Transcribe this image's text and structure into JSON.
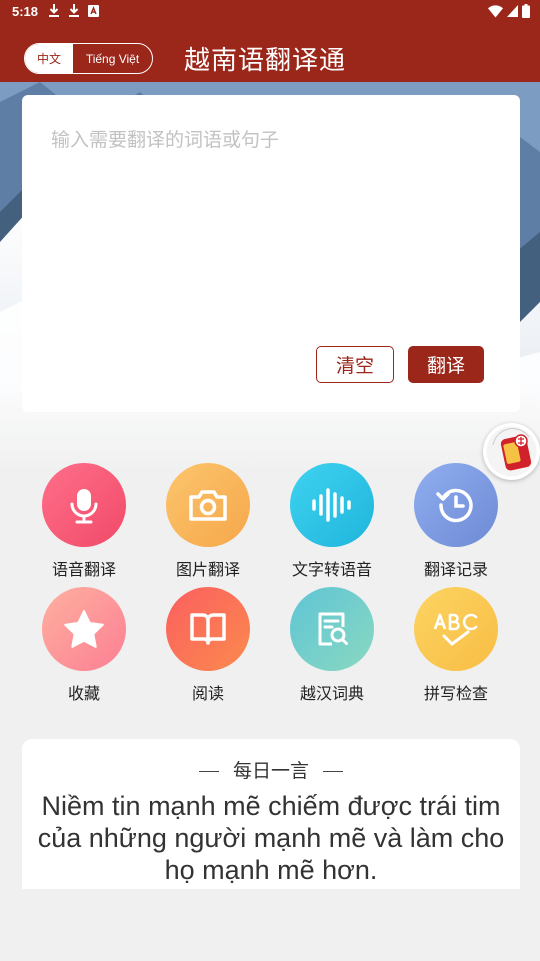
{
  "status_bar": {
    "time": "5:18",
    "icons": [
      "download-icon",
      "download-icon",
      "app-notification-icon",
      "wifi-icon",
      "signal-icon",
      "battery-icon"
    ]
  },
  "header": {
    "lang_cn": "中文",
    "lang_vi": "Tiếng Việt",
    "title": "越南语翻译通"
  },
  "input": {
    "placeholder": "输入需要翻译的词语或句子",
    "value": ""
  },
  "buttons": {
    "clear": "清空",
    "translate": "翻译"
  },
  "features": [
    {
      "label": "语音翻译",
      "icon": "microphone-icon",
      "color": "#f2566f"
    },
    {
      "label": "图片翻译",
      "icon": "camera-icon",
      "color": "#f8b35a"
    },
    {
      "label": "文字转语音",
      "icon": "sound-wave-icon",
      "color": "#2bc3e4"
    },
    {
      "label": "翻译记录",
      "icon": "history-icon",
      "color": "#7f9fe0"
    },
    {
      "label": "收藏",
      "icon": "star-icon",
      "color": "#fb8e94"
    },
    {
      "label": "阅读",
      "icon": "book-icon",
      "color": "#fb6d58"
    },
    {
      "label": "越汉词典",
      "icon": "dictionary-search-icon",
      "color": "#6ccbc6"
    },
    {
      "label": "拼写检查",
      "icon": "abc-check-icon",
      "color": "#fbc450"
    }
  ],
  "daily_quote": {
    "heading": "每日一言",
    "text": "Niềm tin mạnh mẽ chiếm được trái tim của những người mạnh mẽ và làm cho họ mạnh mẽ hơn."
  },
  "colors": {
    "brand": "#9b261a"
  }
}
